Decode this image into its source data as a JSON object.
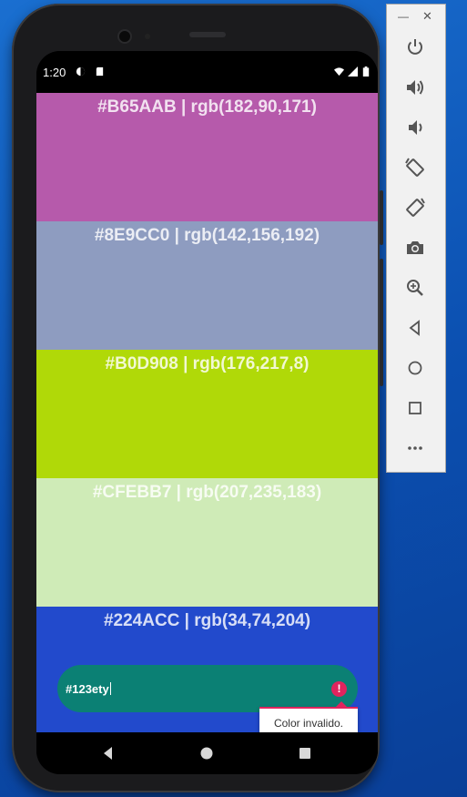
{
  "status_bar": {
    "time": "1:20"
  },
  "swatches": [
    {
      "label": "#B65AAB | rgb(182,90,171)",
      "color": "#B65AAB"
    },
    {
      "label": "#8E9CC0 | rgb(142,156,192)",
      "color": "#8E9CC0"
    },
    {
      "label": "#B0D908 | rgb(176,217,8)",
      "color": "#B0D908"
    },
    {
      "label": "#CFEBB7 | rgb(207,235,183)",
      "color": "#CFEBB7"
    },
    {
      "label": "#224ACC | rgb(34,74,204)",
      "color": "#224ACC"
    }
  ],
  "color_input": {
    "value": "#123ety",
    "error_tooltip": "Color invalido.",
    "pill_color": "#0B8074",
    "error_color": "#E0245E"
  },
  "nav_bar": {
    "icons": [
      "back-icon",
      "home-icon",
      "recents-icon"
    ]
  },
  "emulator_toolbar": {
    "window_controls": [
      "minimize-icon",
      "close-icon"
    ],
    "buttons": [
      "power-icon",
      "volume-up-icon",
      "volume-down-icon",
      "rotate-left-icon",
      "rotate-right-icon",
      "camera-icon",
      "zoom-icon",
      "back-icon",
      "home-icon",
      "overview-icon",
      "more-icon"
    ]
  }
}
